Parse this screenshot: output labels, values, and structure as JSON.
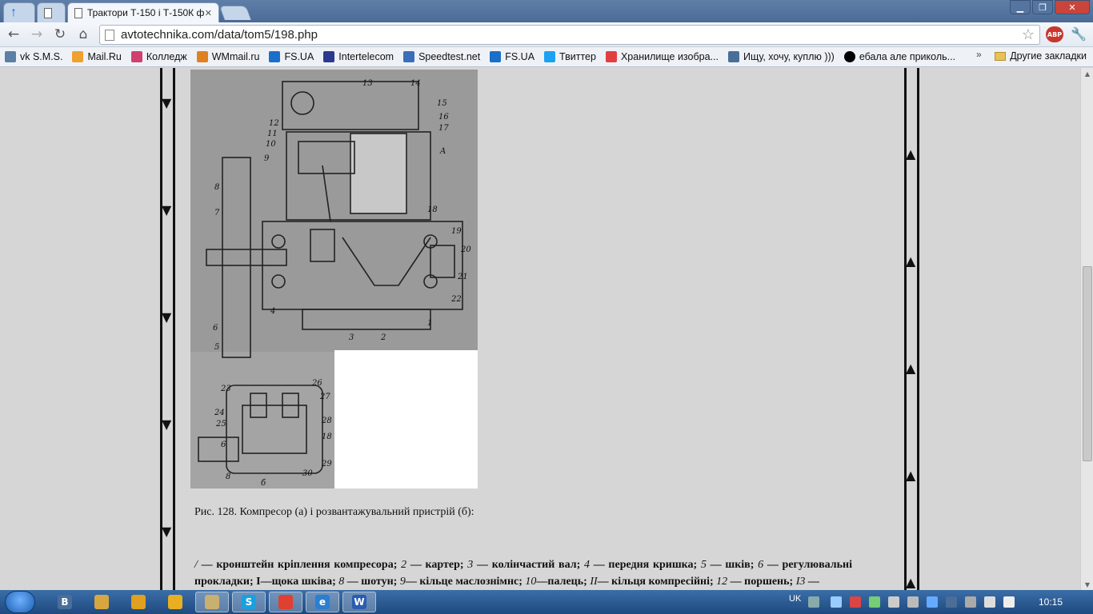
{
  "browser": {
    "tabs": [
      {
        "label": "",
        "icon": "chrome-up-arrow-icon"
      },
      {
        "label": "",
        "icon": "blank-page-icon"
      },
      {
        "label": "Трактори Т-150 і Т-150К ф",
        "icon": "page-icon"
      },
      {
        "label": "",
        "icon": "new-tab-icon"
      }
    ],
    "url": "avtotechnika.com/data/tom5/198.php",
    "abp_label": "ABP",
    "bookmarks": [
      {
        "label": "vk S.M.S.",
        "icon": "vk-icon",
        "color": "#5b7fa6"
      },
      {
        "label": "Mail.Ru",
        "icon": "mailru-icon",
        "color": "#f0a030"
      },
      {
        "label": "Колледж",
        "icon": "rainbow-icon",
        "color": "#d04070"
      },
      {
        "label": "WMmail.ru",
        "icon": "wm-icon",
        "color": "#e08020"
      },
      {
        "label": "FS.UA",
        "icon": "fs-arrow-icon",
        "color": "#1a6fc9"
      },
      {
        "label": "Intertelecom",
        "icon": "intertelecom-icon",
        "color": "#2b3a8f"
      },
      {
        "label": "Speedtest.net",
        "icon": "speedtest-icon",
        "color": "#3a6fb8"
      },
      {
        "label": "FS.UA",
        "icon": "fs-arrow-icon",
        "color": "#1a6fc9"
      },
      {
        "label": "Твиттер",
        "icon": "twitter-icon",
        "color": "#1da1f2"
      },
      {
        "label": "Хранилище изобра...",
        "icon": "stripes-icon",
        "color": "#e04040"
      },
      {
        "label": "Ищу, хочу, куплю )))",
        "icon": "vk-b-icon",
        "color": "#4a6e98"
      },
      {
        "label": "ебала але приколь...",
        "icon": "black-circle-icon",
        "color": "#000000"
      }
    ],
    "other_bookmarks": "Другие закладки",
    "overflow": "»"
  },
  "page": {
    "caption": "Рис. 128. Компресор (а) і розвантажувальний пристрій (б):",
    "legend_parts": [
      {
        "t": "/",
        "i": true
      },
      {
        "t": " — кронштейн кріплення компресора; ",
        "i": false
      },
      {
        "t": "2",
        "i": true
      },
      {
        "t": " — картер; ",
        "i": false
      },
      {
        "t": "3",
        "i": true
      },
      {
        "t": " — колінчастий вал; ",
        "i": false
      },
      {
        "t": "4",
        "i": true
      },
      {
        "t": " — передня кришка; ",
        "i": false
      },
      {
        "t": "5",
        "i": true
      },
      {
        "t": " — шків; ",
        "i": false
      },
      {
        "t": "6",
        "i": true
      },
      {
        "t": " — регулювальні прокладки; I—щока шківа; ",
        "i": false
      },
      {
        "t": "8",
        "i": true
      },
      {
        "t": " — шотун; ",
        "i": false
      },
      {
        "t": "9",
        "i": true
      },
      {
        "t": "— кільце маслознімнс; ",
        "i": false
      },
      {
        "t": "10",
        "i": true
      },
      {
        "t": "—палець; ",
        "i": false
      },
      {
        "t": "II",
        "i": true
      },
      {
        "t": "— кільця компресійні; ",
        "i": false
      },
      {
        "t": "12",
        "i": true
      },
      {
        "t": " — поршень; ",
        "i": false
      },
      {
        "t": "I3",
        "i": true
      },
      {
        "t": " —",
        "i": false
      }
    ],
    "figure_labels_a": [
      "13",
      "14",
      "15",
      "16",
      "17",
      "12",
      "11",
      "10",
      "9",
      "A",
      "8",
      "7",
      "18",
      "19",
      "20",
      "21",
      "22",
      "4",
      "1",
      "2",
      "3",
      "6",
      "5"
    ],
    "figure_labels_b": [
      "23",
      "26",
      "27",
      "24",
      "25",
      "28",
      "18",
      "6",
      "29",
      "30",
      "8",
      "б"
    ]
  },
  "taskbar": {
    "items": [
      {
        "icon": "vk-b-icon",
        "label": "B"
      },
      {
        "icon": "file-manager-icon",
        "label": ""
      },
      {
        "icon": "media-player-icon",
        "label": ""
      },
      {
        "icon": "warning-icon",
        "label": ""
      },
      {
        "icon": "explorer-icon",
        "label": ""
      },
      {
        "icon": "skype-icon",
        "label": "S"
      },
      {
        "icon": "chrome-icon",
        "label": ""
      },
      {
        "icon": "ie-icon",
        "label": "e"
      },
      {
        "icon": "word-icon",
        "label": "W"
      }
    ],
    "language": "UK",
    "clock": "10:15"
  }
}
